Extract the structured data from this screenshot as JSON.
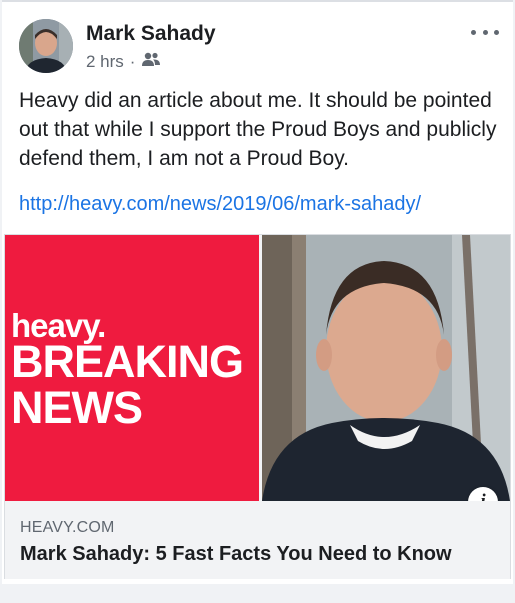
{
  "post": {
    "author": "Mark Sahady",
    "time": "2 hrs",
    "separator": "·",
    "audience_icon": "friends-icon",
    "more_icon": "more-options-icon",
    "text": "Heavy did an article about me.  It should be pointed out that while I support the Proud Boys and publicly defend them, I am not a Proud Boy.",
    "link": "http://heavy.com/news/2019/06/mark-sahady/"
  },
  "preview": {
    "image_brand": "heavy.",
    "image_headline_1": "BREAKING",
    "image_headline_2": "NEWS",
    "domain": "HEAVY.COM",
    "title": "Mark Sahady: 5 Fast Facts You Need to Know",
    "info_icon": "info-icon",
    "info_glyph": "i"
  },
  "colors": {
    "brand_red": "#ef1b3f",
    "link_blue": "#1b74e4",
    "text": "#1c1e21",
    "secondary_text": "#606770"
  }
}
